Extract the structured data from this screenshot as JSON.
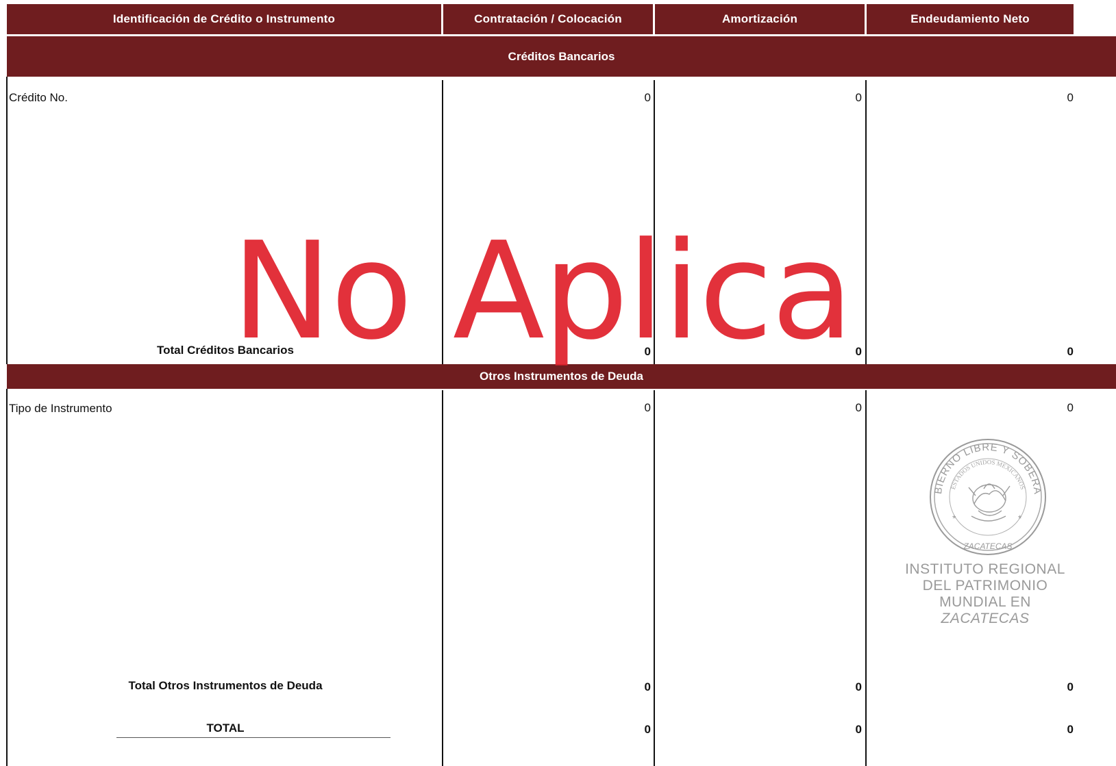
{
  "columns": {
    "identificacion": "Identificación de Crédito o Instrumento",
    "contratacion": "Contratación / Colocación",
    "amortizacion": "Amortización",
    "endeudamiento": "Endeudamiento Neto"
  },
  "section_bancarios": {
    "title": "Créditos Bancarios",
    "row_label": "Crédito No.",
    "row_values": [
      "0",
      "0",
      "0"
    ],
    "total_label": "Total Créditos Bancarios",
    "total_values": [
      "0",
      "0",
      "0"
    ]
  },
  "section_otros": {
    "title": "Otros Instrumentos de Deuda",
    "row_label": "Tipo de Instrumento",
    "row_values": [
      "0",
      "0",
      "0"
    ],
    "total_label": "Total Otros Instrumentos de Deuda",
    "total_values": [
      "0",
      "0",
      "0"
    ]
  },
  "grand_total": {
    "label": "TOTAL",
    "values": [
      "0",
      "0",
      "0"
    ]
  },
  "watermark": "No Aplica",
  "seal": {
    "ring_text": "GOBIERNO LIBRE Y SOBERANO",
    "inner_text": "ESTADOS UNIDOS MEXICANOS",
    "state": "ZACATECAS",
    "caption_lines": [
      "INSTITUTO REGIONAL",
      "DEL PATRIMONIO",
      "MUNDIAL EN",
      "ZACATECAS"
    ]
  },
  "colors": {
    "header_bg": "#6f1d1f",
    "watermark": "#e0222d",
    "seal": "#9a9a9a"
  }
}
